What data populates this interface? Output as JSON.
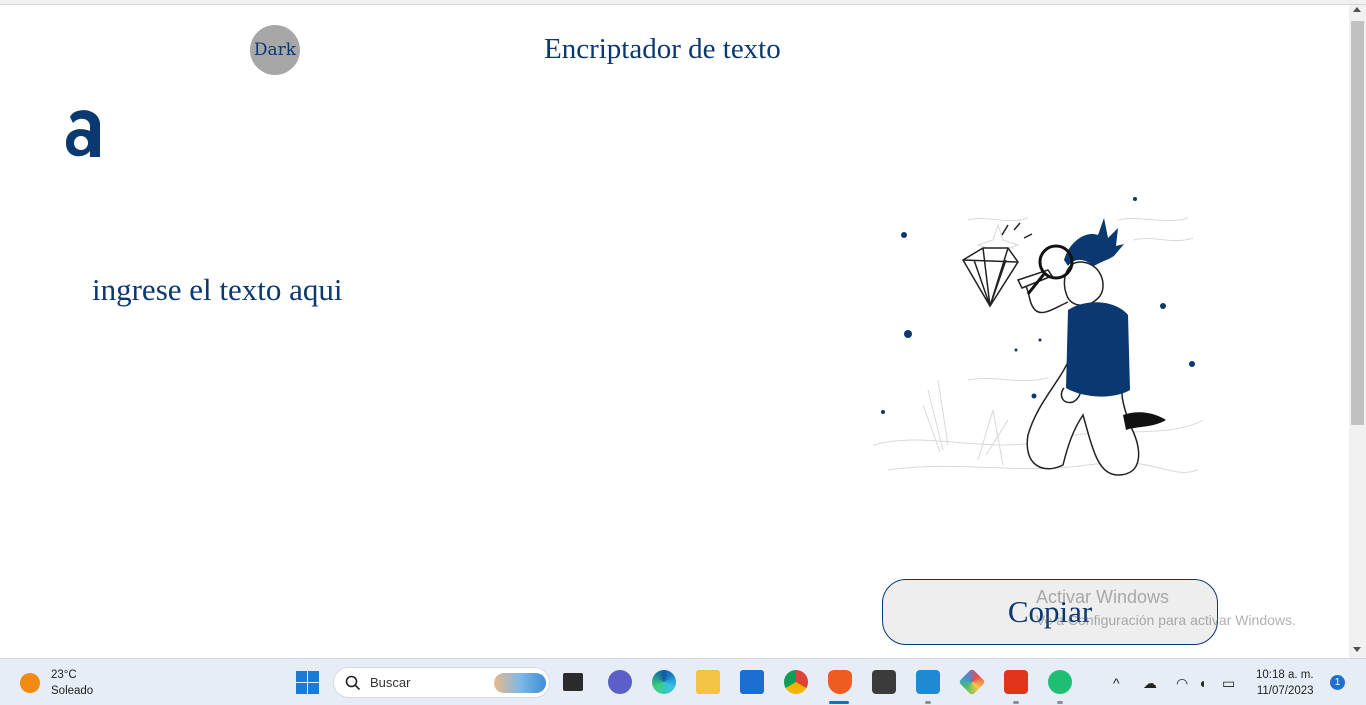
{
  "page": {
    "dark_label": "Dark",
    "title": "Encriptador de texto",
    "input_placeholder": "ingrese el texto aqui",
    "copy_label": "Copiar"
  },
  "watermark": {
    "line1": "Activar Windows",
    "line2": "Ve a Configuración para activar Windows."
  },
  "taskbar": {
    "weather_temp": "23°C",
    "weather_desc": "Soleado",
    "search_placeholder": "Buscar",
    "time": "10:18 a. m.",
    "date": "11/07/2023",
    "notifications": "1"
  },
  "colors": {
    "brand": "#0a3871",
    "dark_button": "#a7a7a7",
    "copy_button_bg": "#eeeeee"
  }
}
